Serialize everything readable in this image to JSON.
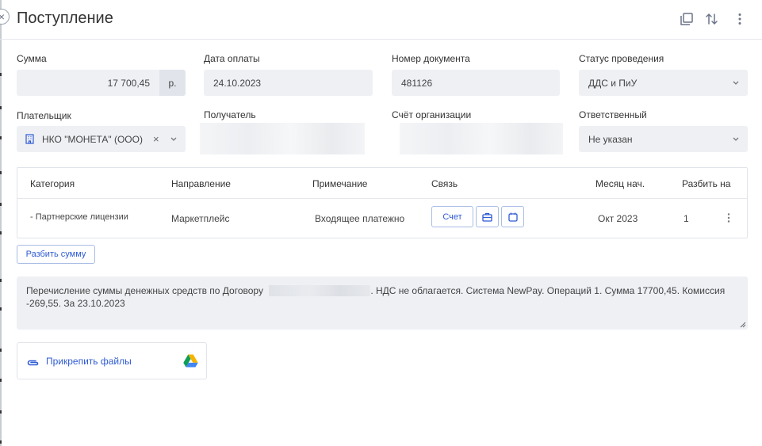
{
  "header": {
    "title": "Поступление"
  },
  "fields": {
    "amount": {
      "label": "Сумма",
      "value": "17 700,45",
      "unit": "р."
    },
    "payment_date": {
      "label": "Дата оплаты",
      "value": "24.10.2023"
    },
    "doc_number": {
      "label": "Номер документа",
      "value": "481126"
    },
    "status": {
      "label": "Статус проведения",
      "value": "ДДС и ПиУ"
    },
    "payer": {
      "label": "Плательщик",
      "value": "НКО \"МОНЕТА\" (ООО)"
    },
    "recipient": {
      "label": "Получатель"
    },
    "org_account": {
      "label": "Счёт организации"
    },
    "responsible": {
      "label": "Ответственный",
      "value": "Не указан"
    }
  },
  "table": {
    "headers": [
      "Категория",
      "Направление",
      "Примечание",
      "Связь",
      "Месяц нач.",
      "Разбить на"
    ],
    "row": {
      "category": "- Партнерские лицензии",
      "direction": "Маркетплейс",
      "note": "Входящее платежно",
      "link_button": "Счет",
      "month": "Окт 2023",
      "split": "1"
    }
  },
  "split_button": "Разбить сумму",
  "comment": {
    "part1": "Перечисление суммы денежных средств по Договору",
    "part2": ". НДС не облагается. Система NewPay. Операций 1. Сумма 17700,45. Комиссия -269,55. За 23.10.2023"
  },
  "attach": {
    "label": "Прикрепить файлы"
  }
}
